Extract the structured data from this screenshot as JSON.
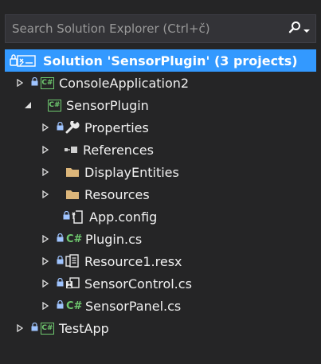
{
  "search": {
    "placeholder": "Search Solution Explorer (Ctrl+č)"
  },
  "tree": {
    "solution_label": "Solution 'SensorPlugin' (3 projects)",
    "items": [
      {
        "label": "ConsoleApplication2"
      },
      {
        "label": "SensorPlugin"
      },
      {
        "label": "Properties"
      },
      {
        "label": "References"
      },
      {
        "label": "DisplayEntities"
      },
      {
        "label": "Resources"
      },
      {
        "label": "App.config"
      },
      {
        "label": "Plugin.cs"
      },
      {
        "label": "Resource1.resx"
      },
      {
        "label": "SensorControl.cs"
      },
      {
        "label": "SensorPanel.cs"
      },
      {
        "label": "TestApp"
      }
    ]
  },
  "icons": {
    "lock": "🔒",
    "cs_project": "C#",
    "cs_file": "C#"
  },
  "colors": {
    "background": "#252526",
    "selection": "#3399ff",
    "csharp_green": "#6fc96f",
    "folder_yellow": "#dcb67a"
  }
}
